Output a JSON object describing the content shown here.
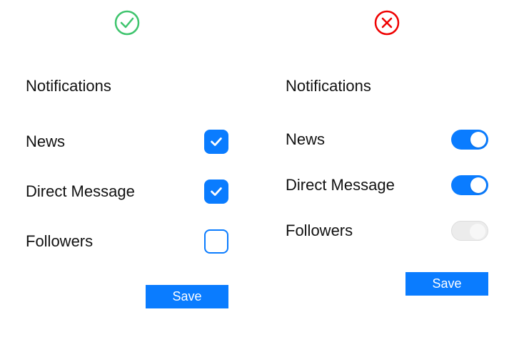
{
  "left": {
    "badge": "good",
    "heading": "Notifications",
    "options": [
      {
        "label": "News",
        "checked": true
      },
      {
        "label": "Direct Message",
        "checked": true
      },
      {
        "label": "Followers",
        "checked": false
      }
    ],
    "save_label": "Save"
  },
  "right": {
    "badge": "bad",
    "heading": "Notifications",
    "options": [
      {
        "label": "News",
        "on": true
      },
      {
        "label": "Direct Message",
        "on": true
      },
      {
        "label": "Followers",
        "on": false
      }
    ],
    "save_label": "Save"
  },
  "colors": {
    "accent": "#0a7cff",
    "good": "#3ec46d",
    "bad": "#ef0000"
  }
}
